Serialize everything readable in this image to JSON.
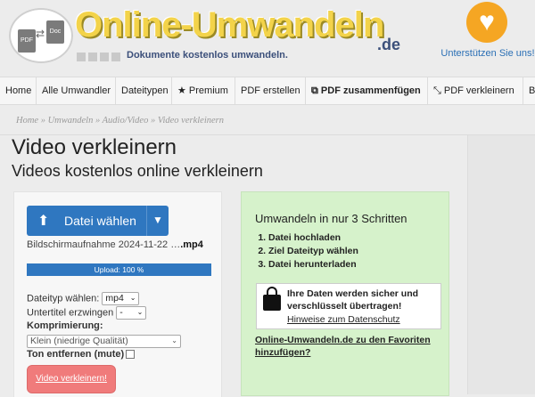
{
  "brand": {
    "name": "Online-Umwandeln",
    "tld": ".de",
    "tagline": "Dokumente kostenlos umwandeln.",
    "badge_left": "PDF",
    "badge_right": "Doc"
  },
  "support": {
    "label": "Unterstützen Sie uns!",
    "icon": "heart-icon"
  },
  "nav": {
    "items": [
      {
        "label": "Home"
      },
      {
        "label": "Alle Umwandler"
      },
      {
        "label": "Dateitypen"
      },
      {
        "label": "Premium",
        "icon": "star-icon"
      },
      {
        "label": "PDF erstellen"
      },
      {
        "label": "PDF zusammenfügen",
        "icon": "copy-icon"
      },
      {
        "label": "PDF verkleinern",
        "icon": "compress-icon"
      },
      {
        "label": "B"
      }
    ]
  },
  "breadcrumb": "Home » Umwandeln » Audio/Video » Video verkleinern",
  "page": {
    "title": "Video verkleinern",
    "subtitle": "Videos kostenlos online verkleinern"
  },
  "upload": {
    "button_label": "Datei wählen",
    "filename_prefix": "Bildschirmaufnahme 2024-11-22 …",
    "filename_ext": ".mp4",
    "progress_label": "Upload: 100 %",
    "progress": 1.0,
    "filetype_label": "Dateityp wählen:",
    "filetype_value": "mp4",
    "subtitles_label": "Untertitel erzwingen",
    "subtitles_value": "-",
    "compression_label": "Komprimierung:",
    "compression_value": "Klein (niedrige Qualität)",
    "mute_label": "Ton entfernen (mute)",
    "submit_label": "Video verkleinern!"
  },
  "steps": {
    "title": "Umwandeln in nur 3 Schritten",
    "items": [
      "Datei hochladen",
      "Ziel Dateityp wählen",
      "Datei herunterladen"
    ],
    "secure_text_1": "Ihre Daten werden sicher und",
    "secure_text_2": "verschlüsselt übertragen!",
    "privacy_link": "Hinweise zum Datenschutz",
    "favorites_link": "Online-Umwandeln.de zu den Favoriten hinzufügen?"
  },
  "colors": {
    "primary": "#2f77c0",
    "submit": "#f07b7b",
    "steps_bg": "#d6f2cb",
    "support": "#f5a623"
  }
}
